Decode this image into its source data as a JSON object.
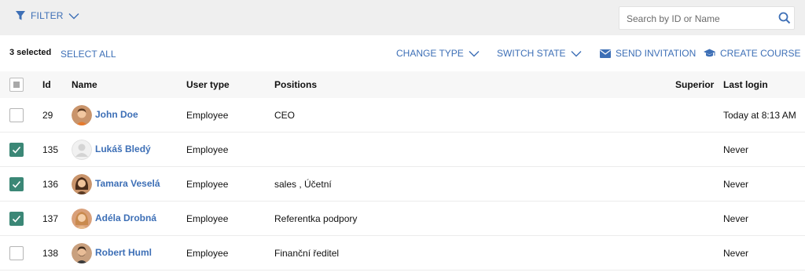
{
  "filter": {
    "label": "FILTER"
  },
  "search": {
    "placeholder": "Search by ID or Name"
  },
  "toolbar": {
    "selected_count": "3 selected",
    "select_all": "SELECT ALL",
    "change_type": "CHANGE TYPE",
    "switch_state": "SWITCH STATE",
    "send_invitation": "SEND INVITATION",
    "create_course": "CREATE COURSE"
  },
  "columns": {
    "id": "Id",
    "name": "Name",
    "user_type": "User type",
    "positions": "Positions",
    "superior": "Superior",
    "last_login": "Last login"
  },
  "rows": [
    {
      "checked": false,
      "id": "29",
      "name": "John Doe",
      "avatar": "man-avatar",
      "user_type": "Employee",
      "positions": "CEO",
      "superior": "",
      "last_login": "Today at 8:13 AM"
    },
    {
      "checked": true,
      "id": "135",
      "name": "Lukáš Bledý",
      "avatar": "placeholder-avatar",
      "user_type": "Employee",
      "positions": "",
      "superior": "",
      "last_login": "Never"
    },
    {
      "checked": true,
      "id": "136",
      "name": "Tamara Veselá",
      "avatar": "woman-avatar",
      "user_type": "Employee",
      "positions": "sales , Účetní",
      "superior": "",
      "last_login": "Never"
    },
    {
      "checked": true,
      "id": "137",
      "name": "Adéla Drobná",
      "avatar": "woman-blonde-avatar",
      "user_type": "Employee",
      "positions": "Referentka podpory",
      "superior": "",
      "last_login": "Never"
    },
    {
      "checked": false,
      "id": "138",
      "name": "Robert Huml",
      "avatar": "bearded-man-avatar",
      "user_type": "Employee",
      "positions": "Finanční ředitel",
      "superior": "",
      "last_login": "Never"
    }
  ],
  "colors": {
    "accent": "#3d6fb6",
    "checked": "#3b8776",
    "topbar": "#efefef"
  }
}
